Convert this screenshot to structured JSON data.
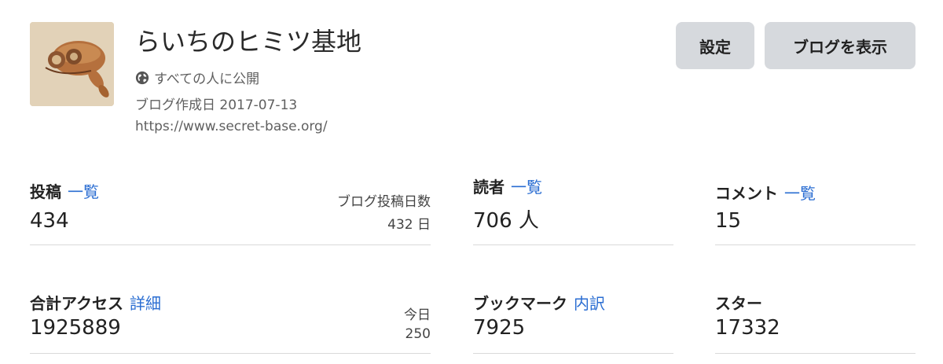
{
  "blog": {
    "title": "らいちのヒミツ基地",
    "visibility": "すべての人に公開",
    "created": "ブログ作成日 2017-07-13",
    "url": "https://www.secret-base.org/",
    "icons": {
      "visibility": "globe-icon"
    }
  },
  "buttons": {
    "settings": "設定",
    "view_blog": "ブログを表示"
  },
  "stats": {
    "posts": {
      "label": "投稿",
      "link": "一覧",
      "value": "434",
      "side_label": "ブログ投稿日数",
      "side_value": "432 日"
    },
    "readers": {
      "label": "読者",
      "link": "一覧",
      "value": "706 人"
    },
    "comments": {
      "label": "コメント",
      "link": "一覧",
      "value": "15"
    },
    "access": {
      "label": "合計アクセス",
      "link": "詳細",
      "value": "1925889",
      "side_label": "今日",
      "side_value": "250"
    },
    "bookmarks": {
      "label": "ブックマーク",
      "link": "内訳",
      "value": "7925"
    },
    "stars": {
      "label": "スター",
      "value": "17332"
    }
  },
  "colors": {
    "link": "#2a6dd2",
    "button_bg": "#d6d9dd",
    "divider": "#d9d9d9"
  }
}
